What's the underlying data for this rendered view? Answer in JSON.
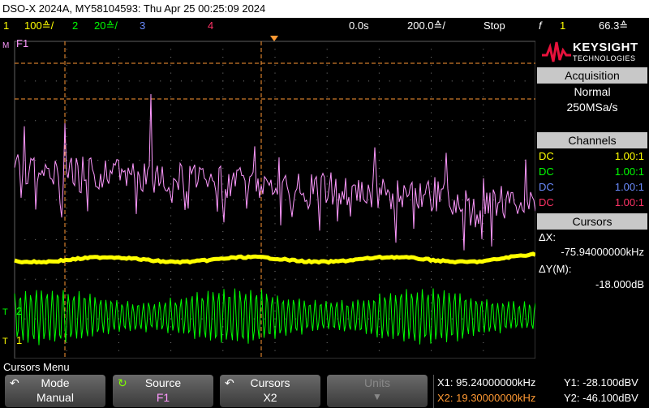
{
  "title_bar": "DSO-X 2024A, MY58104593: Thu Apr 25 00:25:09 2024",
  "status": {
    "ch1": {
      "num": "1",
      "scale": "100≙/",
      "color": "#ffff00"
    },
    "ch2": {
      "num": "2",
      "scale": "20≙/",
      "color": "#00ff00"
    },
    "ch3": {
      "num": "3",
      "color": "#6b8cff"
    },
    "ch4": {
      "num": "4",
      "color": "#ff3366"
    },
    "delay": "0.0s",
    "timebase": "200.0≙/",
    "run_state": "Stop",
    "trigger_icon": "f",
    "trigger_channel": "1",
    "trigger_level": "66.3≙"
  },
  "side": {
    "logo_name": "KEYSIGHT",
    "logo_sub": "TECHNOLOGIES",
    "acq_header": "Acquisition",
    "acq_mode": "Normal",
    "acq_rate": "250MSa/s",
    "channels_header": "Channels",
    "channels": [
      {
        "coupling": "DC",
        "probe": "1.00:1",
        "color": "#ffff00"
      },
      {
        "coupling": "DC",
        "probe": "1.00:1",
        "color": "#00ff00"
      },
      {
        "coupling": "DC",
        "probe": "1.00:1",
        "color": "#6b8cff"
      },
      {
        "coupling": "DC",
        "probe": "1.00:1",
        "color": "#ff3366"
      }
    ],
    "cursors_header": "Cursors",
    "dx_label": "ΔX:",
    "dx_value": "-75.94000000kHz",
    "dy_label": "ΔY(M):",
    "dy_value": "-18.000dB"
  },
  "plot": {
    "math_label": "F1",
    "ch1_marker": "1",
    "ch2_marker": "2"
  },
  "softkeys": {
    "menu_title": "Cursors Menu",
    "mode": {
      "label": "Mode",
      "value": "Manual"
    },
    "source": {
      "label": "Source",
      "value": "F1"
    },
    "cursors": {
      "label": "Cursors",
      "value": "X2"
    },
    "units": {
      "label": "Units"
    }
  },
  "readout": {
    "x1": "X1: 95.24000000kHz",
    "x2": "X2: 19.30000000kHz",
    "y1": "Y1: -28.100dBV",
    "y2": "Y2: -46.100dBV"
  },
  "colors": {
    "ch1": "#ffff00",
    "ch2": "#00ff00",
    "math": "#ff99ff",
    "cursor": "#ff9933",
    "grid": "#808080"
  }
}
